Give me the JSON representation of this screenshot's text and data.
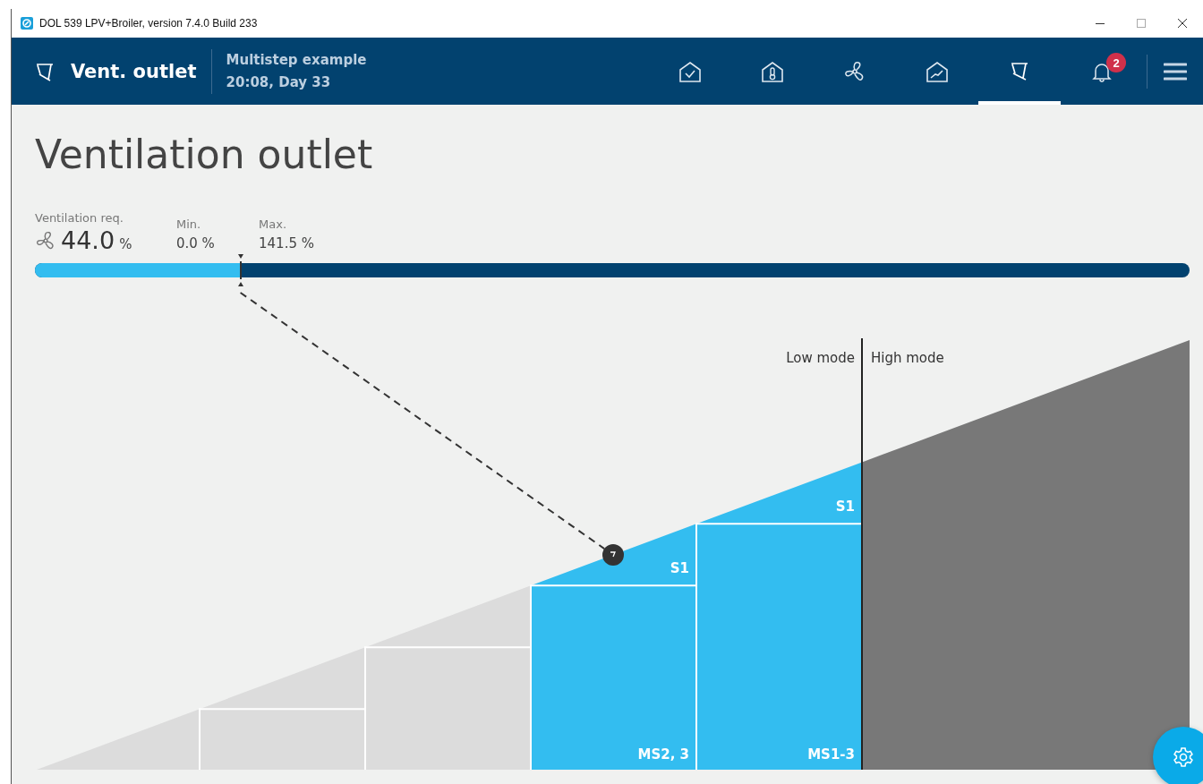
{
  "window": {
    "title": "DOL 539 LPV+Broiler, version 7.4.0 Build 233"
  },
  "header": {
    "title": "Vent. outlet",
    "subtitle": "Multistep example",
    "time": "20:08, Day 33"
  },
  "nav": [
    {
      "kind": "status",
      "selected": false
    },
    {
      "kind": "climate",
      "selected": false
    },
    {
      "kind": "ventilation",
      "selected": false
    },
    {
      "kind": "graphs",
      "selected": false
    },
    {
      "kind": "outlet",
      "selected": true
    },
    {
      "kind": "alarms",
      "selected": false,
      "badge": "2"
    }
  ],
  "page": {
    "title": "Ventilation outlet"
  },
  "ventilation": {
    "label": "Ventilation req.",
    "value": "44.0",
    "unit": "%",
    "min_label": "Min.",
    "min": "0.0 %",
    "max_label": "Max.",
    "max": "141.5 %",
    "level": 0.178
  },
  "diagram": {
    "low_mode": "Low mode",
    "high_mode": "High mode",
    "level": 0.5,
    "steps": [
      {
        "active": false
      },
      {
        "active": false
      },
      {
        "active": false
      },
      {
        "active": true,
        "top_label": "S1",
        "bottom_label": "MS2, 3"
      },
      {
        "active": true,
        "top_label": "S1",
        "bottom_label": "MS1-3"
      }
    ]
  }
}
